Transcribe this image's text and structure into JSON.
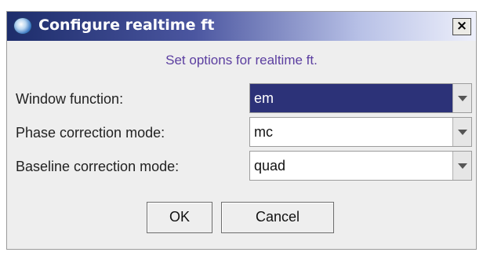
{
  "window": {
    "title": "Configure realtime ft",
    "close_label": "×"
  },
  "subtitle": "Set options for realtime ft.",
  "fields": [
    {
      "label": "Window function:",
      "value": "em"
    },
    {
      "label": "Phase correction mode:",
      "value": "mc"
    },
    {
      "label": "Baseline correction mode:",
      "value": "quad"
    }
  ],
  "buttons": {
    "ok_label": "OK",
    "cancel_label": "Cancel"
  },
  "colors": {
    "title_gradient_start": "#1d2d6b",
    "subtitle": "#5b3ea0",
    "selected_combo": "#2c3278"
  },
  "icons": {
    "app": "globe-app-icon",
    "close": "close-icon",
    "dropdown": "chevron-down-icon"
  }
}
